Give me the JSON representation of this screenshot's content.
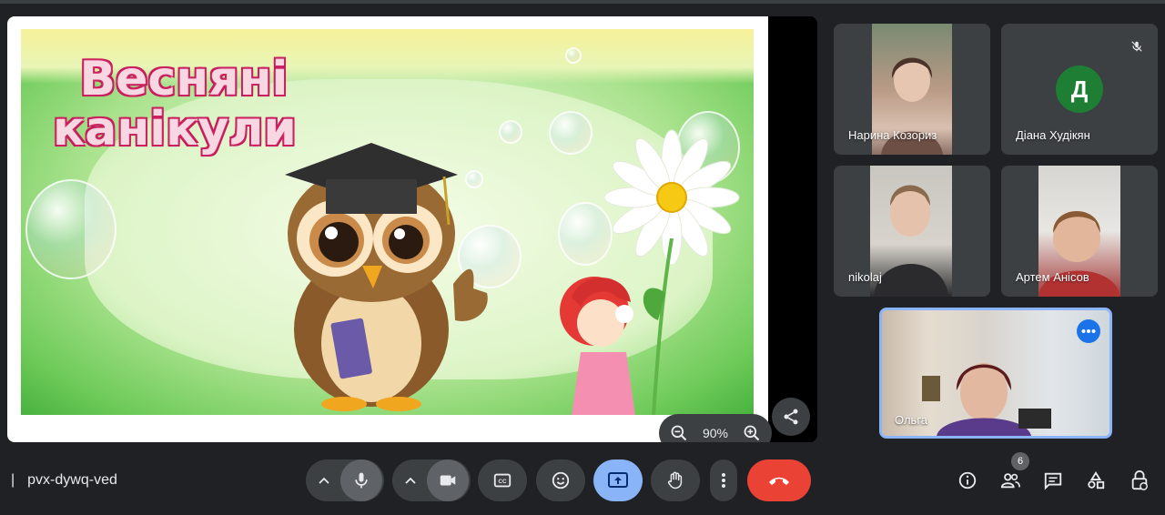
{
  "presentation": {
    "slide_title_line1": "Весняні",
    "slide_title_line2": "канікули",
    "zoom_level": "90%"
  },
  "participants": [
    {
      "name": "Нарина Козориз",
      "video": true
    },
    {
      "name": "Діана Худікян",
      "video": false,
      "initial": "Д",
      "muted": true
    },
    {
      "name": "nikolaj",
      "video": true
    },
    {
      "name": "Артем Анісов",
      "video": true
    }
  ],
  "self_view": {
    "name": "Ольга"
  },
  "meeting": {
    "code": "pvx-dywq-ved",
    "separator": "|"
  },
  "people_count": "6",
  "icons": {
    "zoom_out": "zoom-out-icon",
    "zoom_in": "zoom-in-icon",
    "share": "share-icon",
    "mic": "mic-icon",
    "camera": "camera-icon",
    "captions": "captions-icon",
    "emoji": "emoji-icon",
    "present": "present-icon",
    "hand": "raise-hand-icon",
    "more": "more-vert-icon",
    "hangup": "hangup-icon",
    "info": "info-icon",
    "people": "people-icon",
    "chat": "chat-icon",
    "activities": "activities-icon",
    "lock": "lock-icon"
  },
  "colors": {
    "accent": "#8ab4f8",
    "end_call": "#ea4335",
    "avatar": "#1e7e34"
  }
}
